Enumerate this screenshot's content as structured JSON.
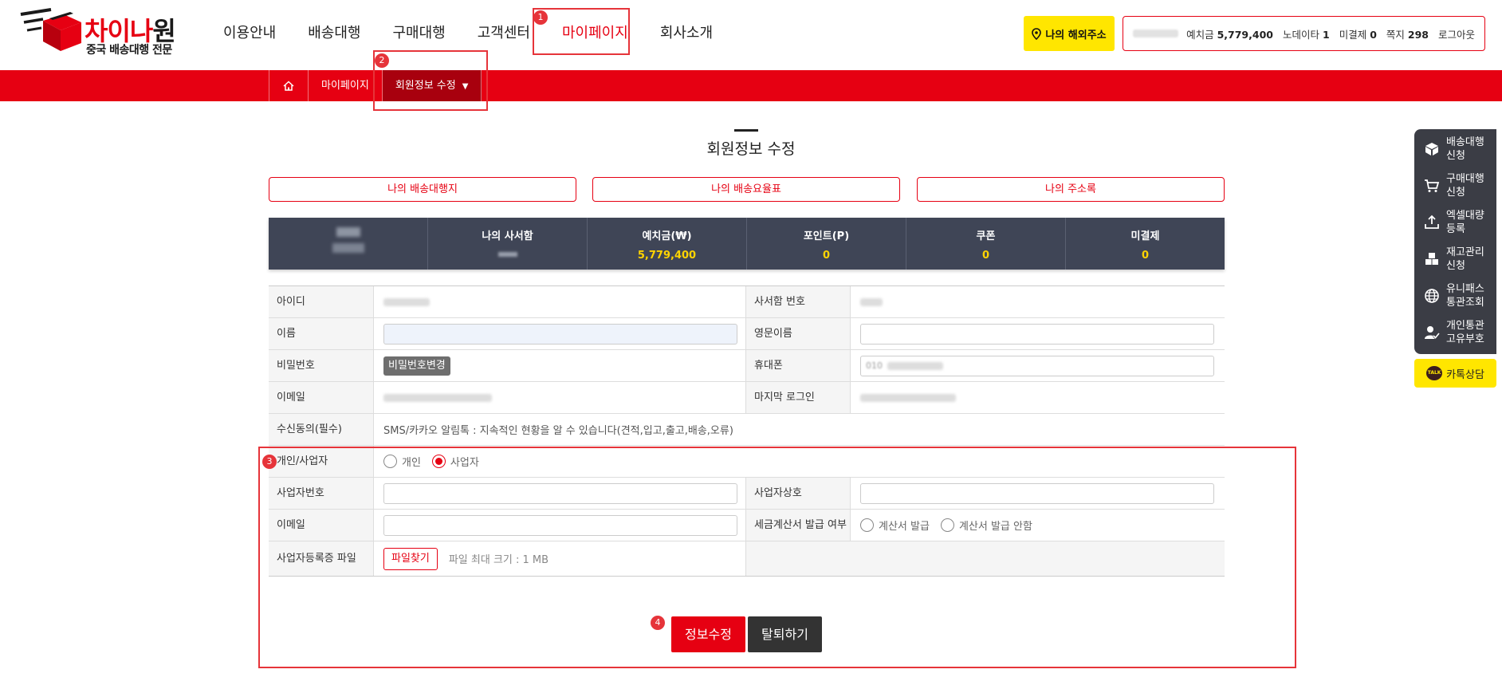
{
  "header": {
    "logo_text_red": "차이나",
    "logo_text_dark": "원",
    "logo_sub": "중국 배송대행 전문",
    "nav": [
      "이용안내",
      "배송대행",
      "구매대행",
      "고객센터",
      "마이페이지",
      "회사소개"
    ],
    "overseas_address_label": "나의 해외주소",
    "userbar": {
      "deposit_label": "예치금",
      "deposit_value": "5,779,400",
      "nodata_label": "노데이타",
      "nodata_value": "1",
      "unpaid_label": "미결제",
      "unpaid_value": "0",
      "notes_label": "쪽지",
      "notes_value": "298",
      "logout": "로그아웃"
    }
  },
  "subnav": {
    "items": [
      "마이페이지",
      "회원정보 수정"
    ]
  },
  "page": {
    "title": "회원정보 수정",
    "tab_buttons": [
      "나의 배송대행지",
      "나의 배송요율표",
      "나의 주소록"
    ]
  },
  "summary": {
    "columns": [
      {
        "label": "",
        "value": ""
      },
      {
        "label": "나의 사서함",
        "value": ""
      },
      {
        "label": "예치금(₩)",
        "value": "5,779,400"
      },
      {
        "label": "포인트(P)",
        "value": "0"
      },
      {
        "label": "쿠폰",
        "value": "0"
      },
      {
        "label": "미결제",
        "value": "0"
      }
    ]
  },
  "form": {
    "id_label": "아이디",
    "mailbox_label": "사서함 번호",
    "name_label": "이름",
    "eng_name_label": "영문이름",
    "password_label": "비밀번호",
    "password_button": "비밀번호변경",
    "phone_label": "휴대폰",
    "phone_value_prefix": "010",
    "email_label": "이메일",
    "last_login_label": "마지막 로그인",
    "consent_label": "수신동의(필수)",
    "consent_text": "SMS/카카오 알림톡 : 지속적인 현황을 알 수 있습니다(견적,입고,출고,배송,오류)",
    "type_label": "개인/사업자",
    "type_options": [
      "개인",
      "사업자"
    ],
    "type_selected": "사업자",
    "biz_no_label": "사업자번호",
    "biz_name_label": "사업자상호",
    "biz_email_label": "이메일",
    "invoice_label": "세금계산서 발급 여부",
    "invoice_options": [
      "계산서 발급",
      "계산서 발급 안함"
    ],
    "file_label": "사업자등록증 파일",
    "file_button": "파일찾기",
    "file_note": "파일 최대 크기 : 1 MB"
  },
  "actions": {
    "submit": "정보수정",
    "withdraw": "탈퇴하기"
  },
  "annotations": [
    "1",
    "2",
    "3",
    "4"
  ],
  "quick_menu": {
    "items": [
      {
        "label": "배송대행 신청",
        "icon": "box-icon"
      },
      {
        "label": "구매대행 신청",
        "icon": "cart-icon"
      },
      {
        "label": "엑셀대량 등록",
        "icon": "upload-icon"
      },
      {
        "label": "재고관리 신청",
        "icon": "boxes-icon"
      },
      {
        "label": "유니패스 통관조회",
        "icon": "globe-icon"
      },
      {
        "label": "개인통관 고유부호",
        "icon": "user-check-icon"
      }
    ],
    "kakao": "카톡상담",
    "kakao_badge": "TALK"
  },
  "colors": {
    "brand_red": "#e60012",
    "dark_panel": "#3f4556",
    "highlight_yellow": "#ffd400",
    "kakao_yellow": "#ffe600"
  }
}
